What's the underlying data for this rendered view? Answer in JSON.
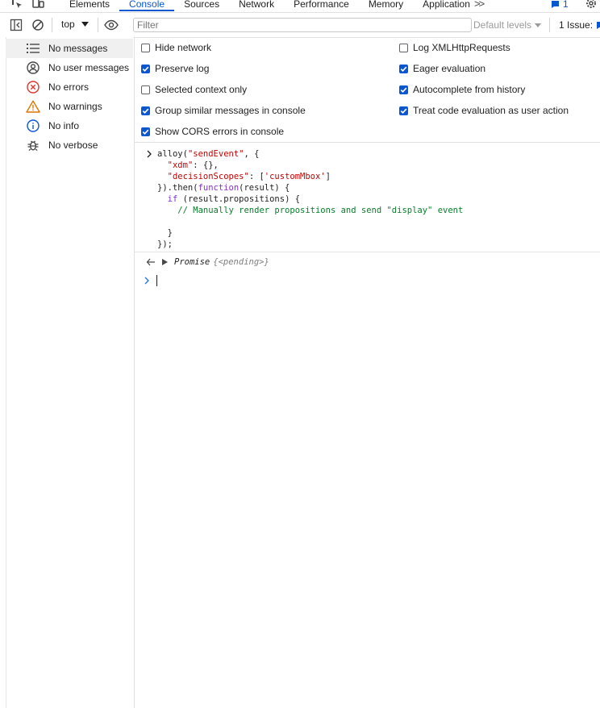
{
  "tabs": {
    "items": [
      "Elements",
      "Console",
      "Sources",
      "Network",
      "Performance",
      "Memory",
      "Application"
    ],
    "active": "Console",
    "more": ">>",
    "message_count": "1"
  },
  "toolbar": {
    "context": "top",
    "filter_placeholder": "Filter",
    "levels": "Default levels",
    "issues_label": "1 Issue:"
  },
  "sidebar": {
    "items": [
      {
        "label": "No messages",
        "icon": "list-icon"
      },
      {
        "label": "No user messages",
        "icon": "user-icon"
      },
      {
        "label": "No errors",
        "icon": "error-icon"
      },
      {
        "label": "No warnings",
        "icon": "warning-icon"
      },
      {
        "label": "No info",
        "icon": "info-icon"
      },
      {
        "label": "No verbose",
        "icon": "bug-icon"
      }
    ]
  },
  "settings": {
    "hide_network": {
      "label": "Hide network",
      "checked": false
    },
    "preserve_log": {
      "label": "Preserve log",
      "checked": true
    },
    "selected_context_only": {
      "label": "Selected context only",
      "checked": false
    },
    "group_similar": {
      "label": "Group similar messages in console",
      "checked": true
    },
    "show_cors": {
      "label": "Show CORS errors in console",
      "checked": true
    },
    "log_xhr": {
      "label": "Log XMLHttpRequests",
      "checked": false
    },
    "eager_evaluation": {
      "label": "Eager evaluation",
      "checked": true
    },
    "autocomplete": {
      "label": "Autocomplete from history",
      "checked": true
    },
    "treat_user_action": {
      "label": "Treat code evaluation as user action",
      "checked": true
    }
  },
  "console": {
    "input_code": "alloy(\"sendEvent\", {\n  \"xdm\": {},\n  \"decisionScopes\": ['customMbox']\n}).then(function(result) {\n  if (result.propositions) {\n    // Manually render propositions and send \"display\" event\n\n  }\n});",
    "result_type": "Promise",
    "result_state": "{<pending>}"
  },
  "colors": {
    "accent": "#0b57d0",
    "string": "#c80000",
    "keyword": "#8430ce",
    "comment": "#0a7d2c",
    "error": "#dc362e",
    "warning": "#e37400"
  }
}
